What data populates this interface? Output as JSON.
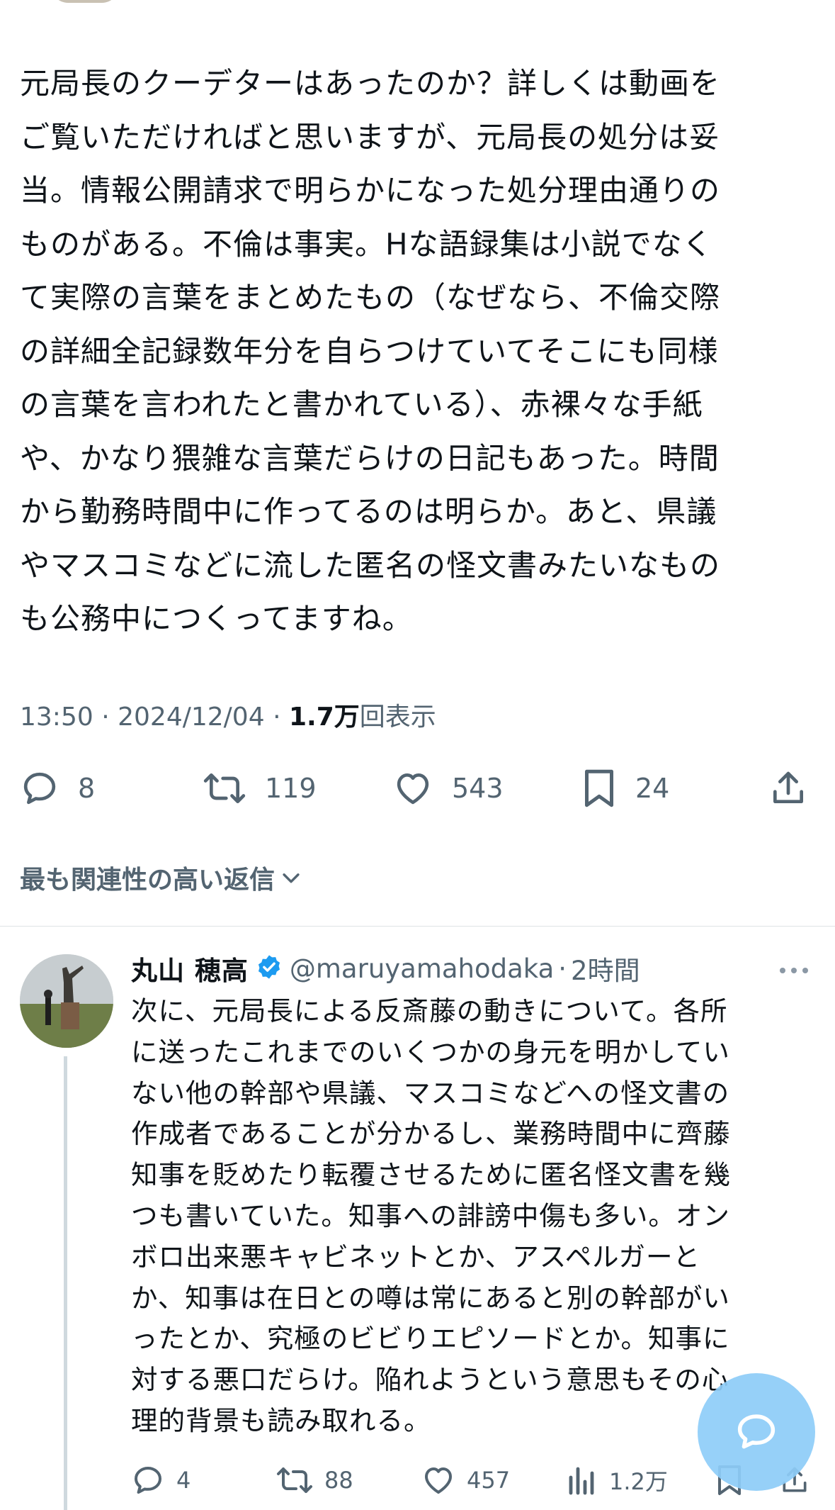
{
  "tweet": {
    "text": "元局長のクーデターはあったのか？詳しくは動画を\nご覧いただければと思いますが、元局長の処分は妥\n当。情報公開請求で明らかになった処分理由通りの\nものがある。不倫は事実。Hな語録集は小説でなく\nて実際の言葉をまとめたもの（なぜなら、不倫交際\nの詳細全記録数年分を自らつけていてそこにも同様\nの言葉を言われたと書かれている）、赤裸々な手紙\nや、かなり猥雑な言葉だらけの日記もあった。時間\nから勤務時間中に作ってるのは明らか。あと、県議\nやマスコミなどに流した匿名の怪文書みたいなもの\nも公務中につくってますね。",
    "time": "13:50",
    "date": "2024/12/04",
    "separator": "·",
    "views_count": "1.7万",
    "views_label": "回表示",
    "stats": {
      "replies": "8",
      "reposts": "119",
      "likes": "543",
      "bookmarks": "24"
    }
  },
  "replies_sort_label": "最も関連性の高い返信",
  "reply": {
    "name": "丸山 穂高",
    "handle": "@maruyamahodaka",
    "separator": "·",
    "time": "2時間",
    "text": "次に、元局長による反斎藤の動きについて。各所\nに送ったこれまでのいくつかの身元を明かしてい\nない他の幹部や県議、マスコミなどへの怪文書の\n作成者であることが分かるし、業務時間中に齊藤\n知事を貶めたり転覆させるために匿名怪文書を幾\nつも書いていた。知事への誹謗中傷も多い。オン\nボロ出来悪キャビネットとか、アスペルガーと\nか、知事は在日との噂は常にあると別の幹部がい\nったとか、究極のビビりエピソードとか。知事に\n対する悪口だらけ。陥れようという意思もその心\n理的背景も読み取れる。",
    "stats": {
      "replies": "4",
      "reposts": "88",
      "likes": "457",
      "views": "1.2万"
    }
  },
  "icons": {
    "reply": "reply-icon",
    "repost": "repost-icon",
    "like": "heart-icon",
    "bookmark": "bookmark-icon",
    "share": "share-icon",
    "views": "views-icon",
    "verified": "verified-badge-icon",
    "more": "more-icon",
    "compose": "compose-icon"
  },
  "colors": {
    "text": "#0f1419",
    "secondary": "#536471",
    "verified": "#1d9bf0",
    "fab": "#8ecdf8"
  }
}
